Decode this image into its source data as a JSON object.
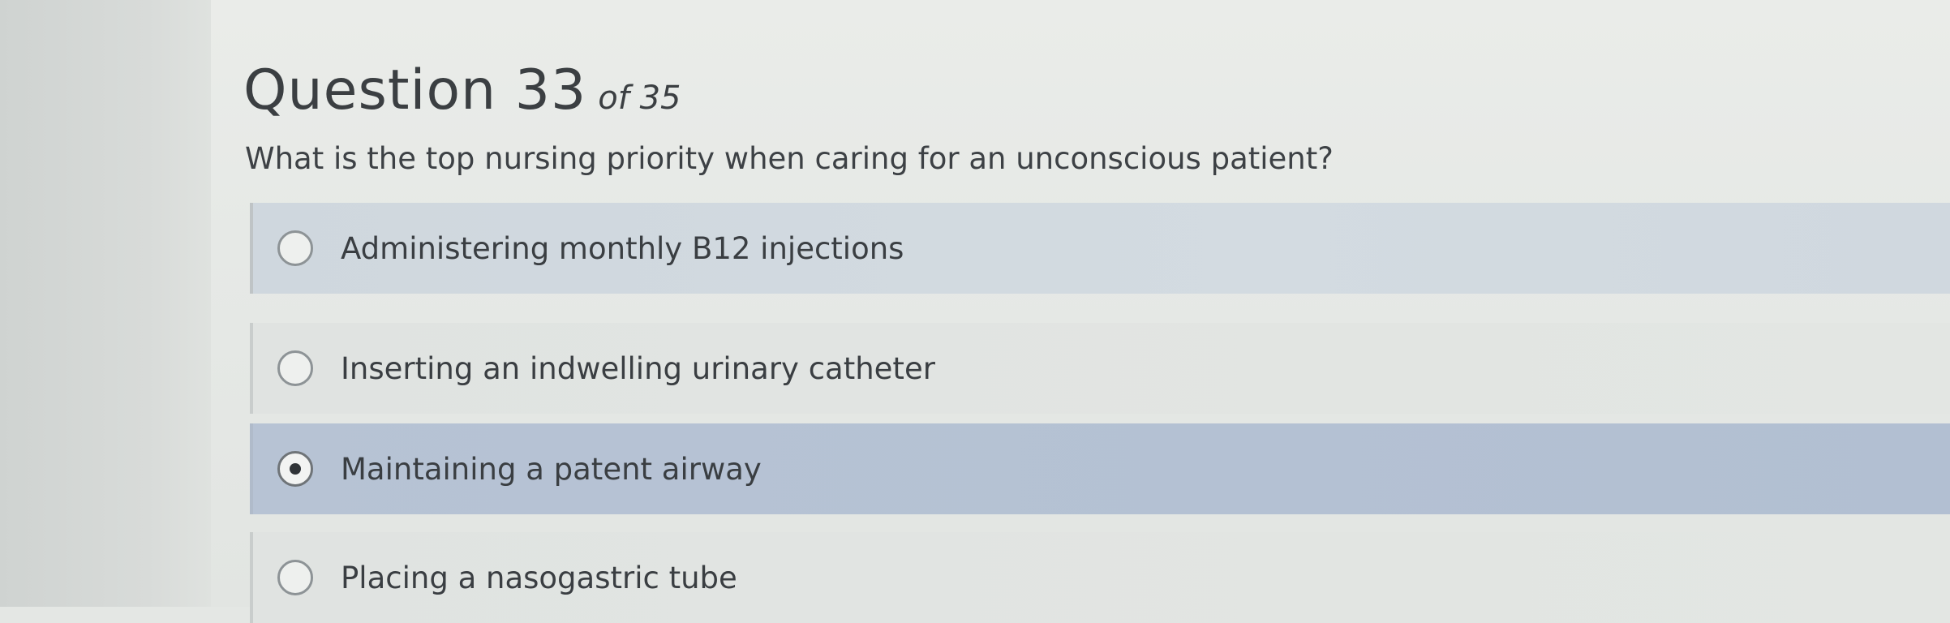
{
  "question": {
    "title": "Question 33",
    "count": "of 35",
    "text": "What is the top nursing priority when caring for an unconscious patient?"
  },
  "options": [
    {
      "label": "Administering monthly B12 injections",
      "selected": false
    },
    {
      "label": "Inserting an indwelling urinary catheter",
      "selected": false
    },
    {
      "label": "Maintaining a patent airway",
      "selected": true
    },
    {
      "label": "Placing a nasogastric tube",
      "selected": false
    }
  ],
  "colors": {
    "selected_bg": "#b5c2d4",
    "hover_bg": "#d1d9df",
    "text": "#3a3e42"
  }
}
